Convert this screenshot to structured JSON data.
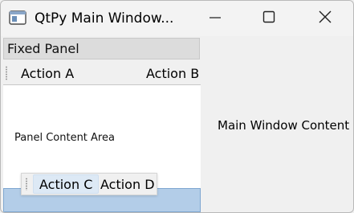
{
  "window": {
    "title": "QtPy Main Window..."
  },
  "dock": {
    "title": "Fixed Panel",
    "toolbar_actions": [
      "Action A",
      "Action B"
    ],
    "content_label": "Panel Content Area"
  },
  "floating_toolbar": {
    "actions": [
      "Action C",
      "Action D"
    ],
    "active_action": "Action C"
  },
  "main": {
    "content_label": "Main Window Content"
  },
  "colors": {
    "drop_highlight": "#b3cde8",
    "active_button": "#dde9f5"
  },
  "icons": {
    "app": "qt-window-icon",
    "minimize": "minimize-icon",
    "maximize": "maximize-icon",
    "close": "close-icon"
  }
}
